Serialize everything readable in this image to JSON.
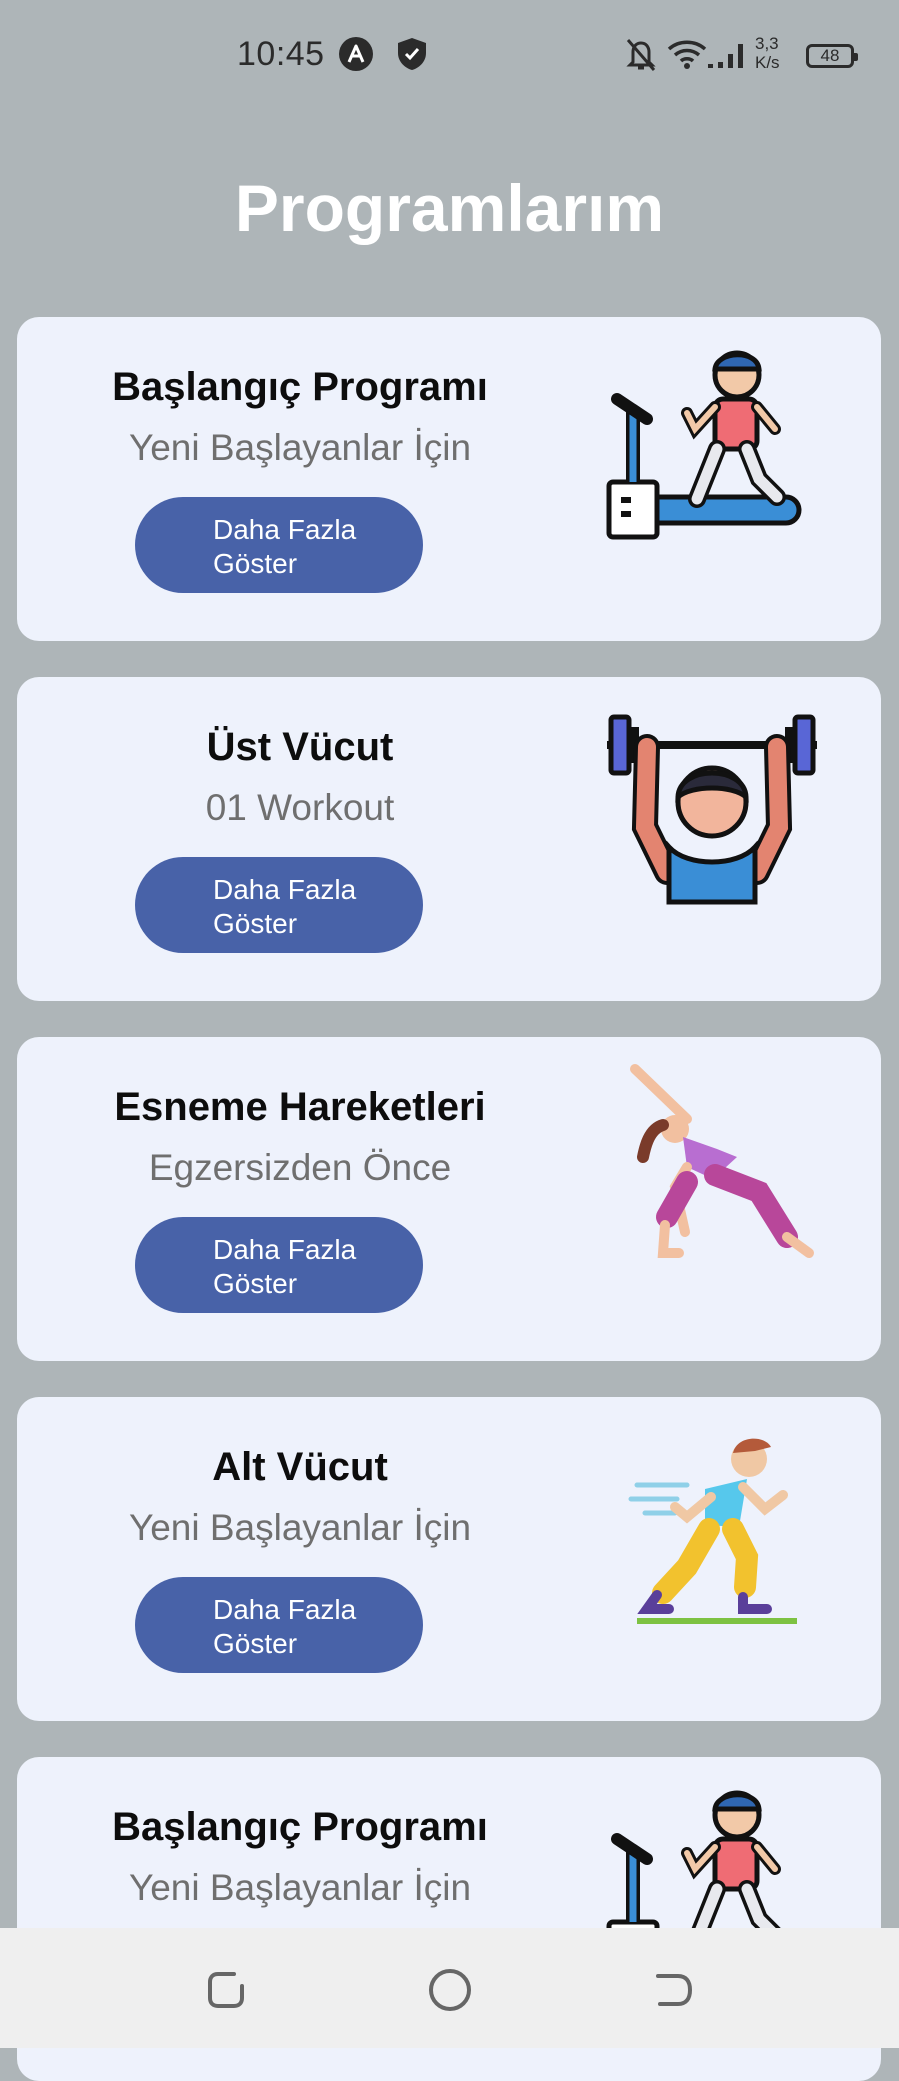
{
  "status_bar": {
    "time": "10:45",
    "net_speed_value": "3,3",
    "net_speed_unit": "K/s",
    "battery_level": "48",
    "icons": [
      "app-a-icon",
      "shield-icon",
      "bell-off-icon",
      "wifi-icon",
      "signal-icon",
      "battery-icon"
    ]
  },
  "page": {
    "title": "Programlarım"
  },
  "colors": {
    "background": "#aeb5b8",
    "card": "#eef2fc",
    "button": "#4862a8"
  },
  "cards": [
    {
      "title": "Başlangıç Programı",
      "subtitle": "Yeni Başlayanlar İçin",
      "button_line1": "Daha Fazla",
      "button_line2": "Göster",
      "icon": "treadmill-runner-icon"
    },
    {
      "title": "Üst Vücut",
      "subtitle": "01 Workout",
      "button_line1": "Daha Fazla",
      "button_line2": "Göster",
      "icon": "weightlifter-icon"
    },
    {
      "title": "Esneme Hareketleri",
      "subtitle": "Egzersizden Önce",
      "button_line1": "Daha Fazla",
      "button_line2": "Göster",
      "icon": "stretching-woman-icon"
    },
    {
      "title": "Alt Vücut",
      "subtitle": "Yeni Başlayanlar İçin",
      "button_line1": "Daha Fazla",
      "button_line2": "Göster",
      "icon": "running-man-icon"
    },
    {
      "title": "Başlangıç Programı",
      "subtitle": "Yeni Başlayanlar İçin",
      "icon": "treadmill-runner-icon"
    }
  ],
  "nav_bar": {
    "buttons": [
      "recent-apps-icon",
      "home-icon",
      "back-icon"
    ]
  }
}
